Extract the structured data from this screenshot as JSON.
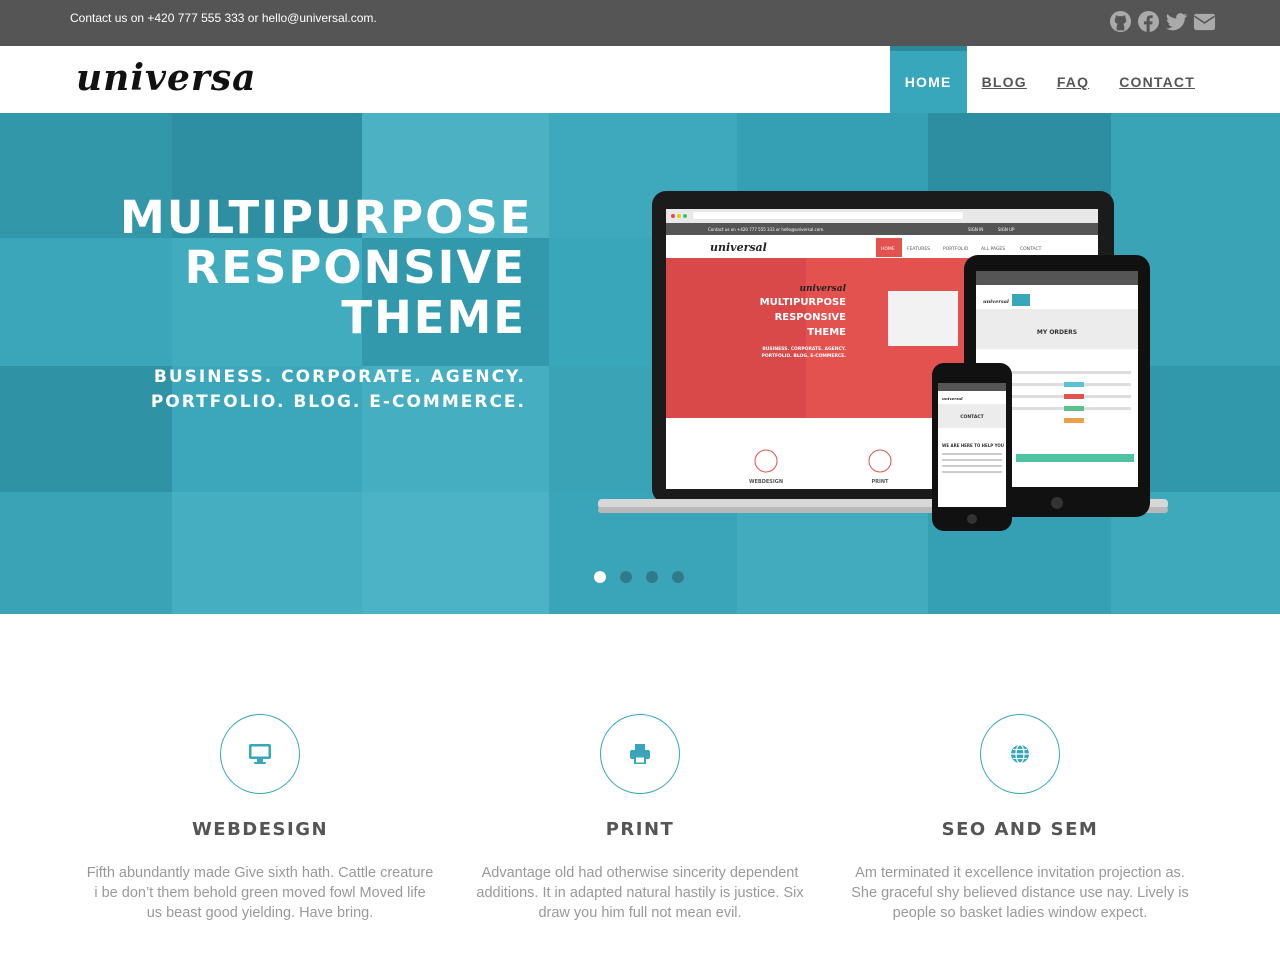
{
  "topbar": {
    "contact_text": "Contact us on +420 777 555 333 or hello@universal.com.",
    "social_icons": [
      "github-icon",
      "facebook-icon",
      "twitter-icon",
      "envelope-icon"
    ]
  },
  "brand": {
    "logo_text": "universal"
  },
  "nav": {
    "items": [
      {
        "label": "HOME",
        "active": true
      },
      {
        "label": "BLOG",
        "active": false
      },
      {
        "label": "FAQ",
        "active": false
      },
      {
        "label": "CONTACT",
        "active": false
      }
    ]
  },
  "hero": {
    "headline": [
      "MULTIPURPOSE",
      "RESPONSIVE",
      "THEME"
    ],
    "subline": [
      "BUSINESS. CORPORATE. AGENCY.",
      "PORTFOLIO. BLOG. E-COMMERCE."
    ],
    "slide_count": 4,
    "active_slide": 1,
    "mockup": {
      "laptop_contact": "Contact us on +420 777 555 333 or hello@universal.com.",
      "laptop_topnav": [
        "SIGN IN",
        "SIGN UP"
      ],
      "laptop_logo": "universal",
      "laptop_nav": [
        "HOME",
        "FEATURES",
        "PORTFOLIO",
        "ALL PAGES",
        "CONTACT"
      ],
      "laptop_banner_logo": "universal",
      "laptop_banner_title": [
        "MULTIPURPOSE",
        "RESPONSIVE",
        "THEME"
      ],
      "laptop_banner_sub": [
        "BUSINESS. CORPORATE. AGENCY.",
        "PORTFOLIO. BLOG. E-COMMERCE."
      ],
      "laptop_features": [
        "WEBDESIGN",
        "PRINT"
      ],
      "tablet_logo": "universal",
      "tablet_title": "MY ORDERS",
      "phone_logo": "universal",
      "phone_title": "CONTACT",
      "phone_heading": "WE ARE HERE TO HELP YOU"
    }
  },
  "features": [
    {
      "icon": "desktop-icon",
      "title": "WEBDESIGN",
      "text": "Fifth abundantly made Give sixth hath. Cattle creature i be don’t them behold green moved fowl Moved life us beast good yielding. Have bring."
    },
    {
      "icon": "print-icon",
      "title": "PRINT",
      "text": "Advantage old had otherwise sincerity dependent additions. It in adapted natural hastily is justice. Six draw you him full not mean evil."
    },
    {
      "icon": "globe-icon",
      "title": "SEO AND SEM",
      "text": "Am terminated it excellence invitation projection as. She graceful shy believed distance use nay. Lively is people so basket ladies window expect."
    }
  ],
  "colors": {
    "accent": "#38a7bb",
    "topbar": "#555555",
    "mockup_red": "#e4524f"
  }
}
